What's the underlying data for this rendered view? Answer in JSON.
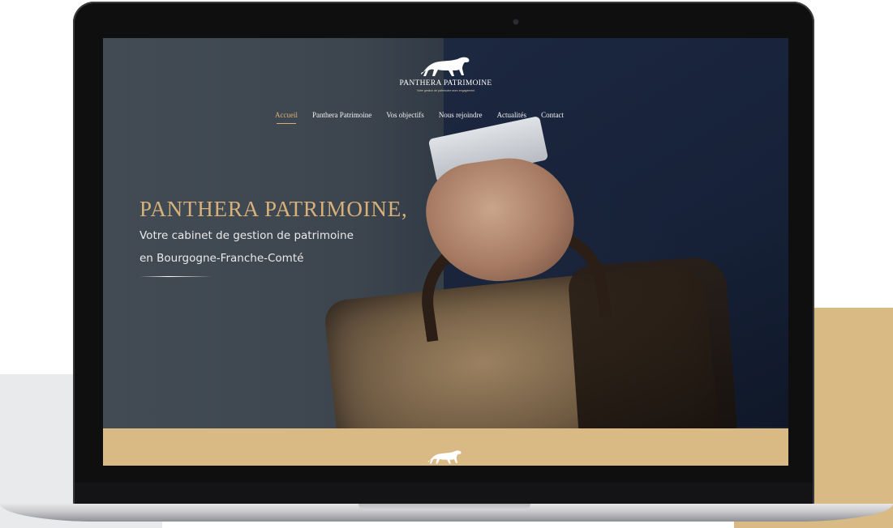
{
  "site": {
    "brand_name": "PANTHERA PATRIMOINE",
    "brand_tagline": "Votre gestion de patrimoine avec engagement"
  },
  "nav": {
    "items": [
      {
        "label": "Accueil",
        "active": true
      },
      {
        "label": "Panthera Patrimoine",
        "active": false
      },
      {
        "label": "Vos objectifs",
        "active": false
      },
      {
        "label": "Nous rejoindre",
        "active": false
      },
      {
        "label": "Actualités",
        "active": false
      },
      {
        "label": "Contact",
        "active": false
      }
    ]
  },
  "hero": {
    "title": "PANTHERA PATRIMOINE,",
    "subtitle_line1": "Votre cabinet de gestion de patrimoine",
    "subtitle_line2": "en Bourgogne-Franche-Comté"
  },
  "colors": {
    "accent_gold": "#d7b07a",
    "band_gold": "#d9b984",
    "hero_dark": "#152032",
    "laptop_bezel": "#0f0f10"
  },
  "icons": {
    "logo": "panther-icon",
    "band": "panther-icon"
  }
}
